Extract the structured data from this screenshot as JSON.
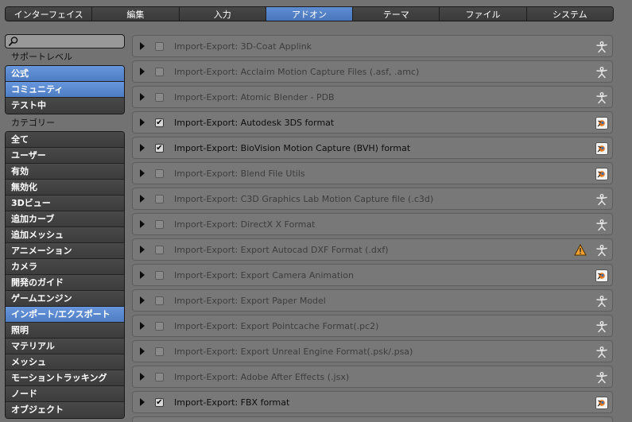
{
  "tabs": [
    {
      "label": "インターフェイス",
      "active": false
    },
    {
      "label": "編集",
      "active": false
    },
    {
      "label": "入力",
      "active": false
    },
    {
      "label": "アドオン",
      "active": true
    },
    {
      "label": "テーマ",
      "active": false
    },
    {
      "label": "ファイル",
      "active": false
    },
    {
      "label": "システム",
      "active": false
    }
  ],
  "sidebar": {
    "search": {
      "value": "",
      "placeholder": ""
    },
    "support_label": "サポートレベル",
    "support_items": [
      {
        "label": "公式",
        "selected": true
      },
      {
        "label": "コミュニティ",
        "selected": true
      },
      {
        "label": "テスト中",
        "selected": false
      }
    ],
    "category_label": "カテゴリー",
    "categories": [
      {
        "label": "全て",
        "selected": false
      },
      {
        "label": "ユーザー",
        "selected": false
      },
      {
        "label": "有効",
        "selected": false
      },
      {
        "label": "無効化",
        "selected": false
      },
      {
        "label": "3Dビュー",
        "selected": false
      },
      {
        "label": "追加カーブ",
        "selected": false
      },
      {
        "label": "追加メッシュ",
        "selected": false
      },
      {
        "label": "アニメーション",
        "selected": false
      },
      {
        "label": "カメラ",
        "selected": false
      },
      {
        "label": "開発のガイド",
        "selected": false
      },
      {
        "label": "ゲームエンジン",
        "selected": false
      },
      {
        "label": "インポート/エクスポート",
        "selected": true
      },
      {
        "label": "照明",
        "selected": false
      },
      {
        "label": "マテリアル",
        "selected": false
      },
      {
        "label": "メッシュ",
        "selected": false
      },
      {
        "label": "モーショントラッキング",
        "selected": false
      },
      {
        "label": "ノード",
        "selected": false
      },
      {
        "label": "オブジェクト",
        "selected": false
      }
    ]
  },
  "addons": [
    {
      "name": "Import-Export: 3D-Coat Applink",
      "enabled": false,
      "icon": "community-icon",
      "warning": false
    },
    {
      "name": "Import-Export: Acclaim Motion Capture Files (.asf, .amc)",
      "enabled": false,
      "icon": "community-icon",
      "warning": false
    },
    {
      "name": "Import-Export: Atomic Blender - PDB",
      "enabled": false,
      "icon": "community-icon",
      "warning": false
    },
    {
      "name": "Import-Export: Autodesk 3DS format",
      "enabled": true,
      "icon": "official-icon",
      "warning": false
    },
    {
      "name": "Import-Export: BioVision Motion Capture (BVH) format",
      "enabled": true,
      "icon": "official-icon",
      "warning": false
    },
    {
      "name": "Import-Export: Blend File Utils",
      "enabled": false,
      "icon": "official-icon",
      "warning": false
    },
    {
      "name": "Import-Export: C3D Graphics Lab Motion Capture file (.c3d)",
      "enabled": false,
      "icon": "community-icon",
      "warning": false
    },
    {
      "name": "Import-Export: DirectX X Format",
      "enabled": false,
      "icon": "community-icon",
      "warning": false
    },
    {
      "name": "Import-Export: Export Autocad DXF Format (.dxf)",
      "enabled": false,
      "icon": "community-icon",
      "warning": true
    },
    {
      "name": "Import-Export: Export Camera Animation",
      "enabled": false,
      "icon": "official-icon",
      "warning": false
    },
    {
      "name": "Import-Export: Export Paper Model",
      "enabled": false,
      "icon": "community-icon",
      "warning": false
    },
    {
      "name": "Import-Export: Export Pointcache Format(.pc2)",
      "enabled": false,
      "icon": "community-icon",
      "warning": false
    },
    {
      "name": "Import-Export: Export Unreal Engine Format(.psk/.psa)",
      "enabled": false,
      "icon": "community-icon",
      "warning": false
    },
    {
      "name": "Import-Export: Adobe After Effects (.jsx)",
      "enabled": false,
      "icon": "community-icon",
      "warning": false
    },
    {
      "name": "Import-Export: FBX format",
      "enabled": true,
      "icon": "official-icon",
      "warning": false
    },
    {
      "name": "",
      "enabled": false,
      "icon": "community-icon",
      "warning": false
    }
  ]
}
